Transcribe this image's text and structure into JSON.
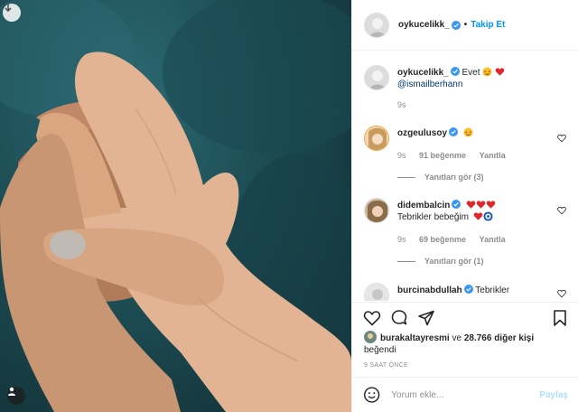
{
  "post": {
    "author": "oykucelikk_",
    "follow_label": "Takip Et",
    "separator": "•"
  },
  "comments": [
    {
      "user": "oykucelikk_",
      "text": "Evet",
      "emojis": [
        "star-struck-emoji",
        "red-heart-emoji"
      ],
      "mention": "@ismailberhann",
      "time": "9s"
    },
    {
      "user": "ozgeulusoy",
      "emojis": [
        "star-struck-emoji"
      ],
      "time": "9s",
      "likes": "91 beğenme",
      "reply": "Yanıtla",
      "view_replies": "Yanıtları gör (3)"
    },
    {
      "user": "didembalcin",
      "emojis_line1": [
        "red-heart-emoji",
        "red-heart-emoji",
        "red-heart-emoji"
      ],
      "text": "Tebrikler bebeğim",
      "emojis_line2": [
        "red-heart-emoji",
        "nazar-amulet-emoji"
      ],
      "time": "9s",
      "likes": "69 beğenme",
      "reply": "Yanıtla",
      "view_replies": "Yanıtları gör (1)"
    },
    {
      "user": "burcinabdullah",
      "text": "Tebrikler"
    }
  ],
  "likes": {
    "user": "burakaltayresmi",
    "connector": "ve",
    "others": "28.766 diğer kişi",
    "suffix": "beğendi"
  },
  "time_ago": "9 SAAT ÖNCE",
  "add_comment": {
    "placeholder": "Yorum ekle...",
    "post_label": "Paylaş"
  },
  "colors": {
    "accent": "#0095f6",
    "verified": "#3897f0",
    "muted": "#8e8e8e",
    "post_disabled": "#b2dffc"
  }
}
